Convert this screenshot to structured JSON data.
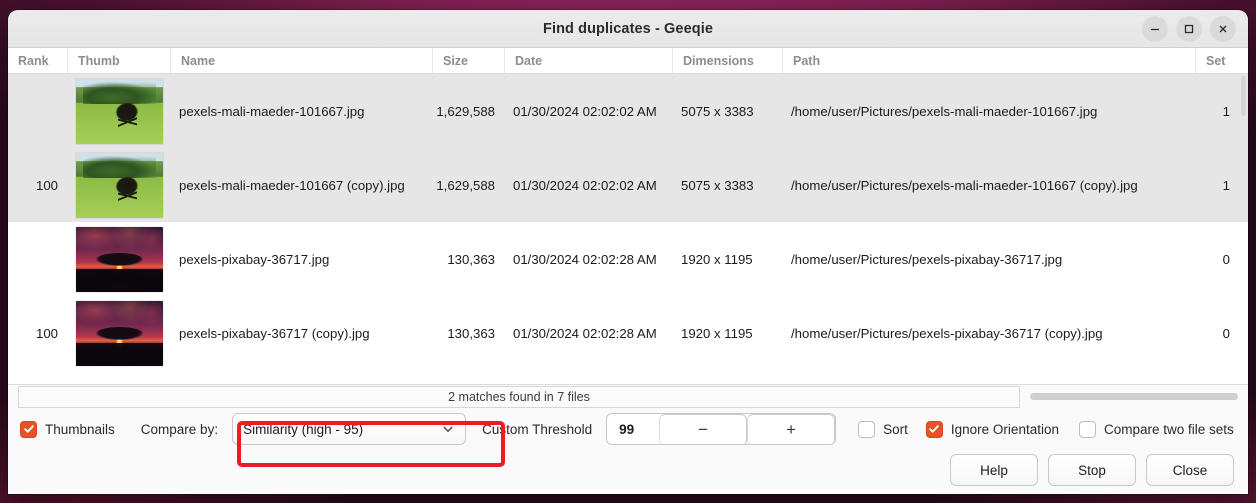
{
  "window": {
    "title": "Find duplicates - Geeqie",
    "controls": [
      {
        "name": "minimize",
        "glyph": "minimize-icon"
      },
      {
        "name": "maximize",
        "glyph": "maximize-icon"
      },
      {
        "name": "close",
        "glyph": "close-icon"
      }
    ]
  },
  "table": {
    "columns": [
      {
        "key": "rank",
        "label": "Rank"
      },
      {
        "key": "thumb",
        "label": "Thumb"
      },
      {
        "key": "name",
        "label": "Name"
      },
      {
        "key": "size",
        "label": "Size"
      },
      {
        "key": "date",
        "label": "Date"
      },
      {
        "key": "dimensions",
        "label": "Dimensions"
      },
      {
        "key": "path",
        "label": "Path"
      },
      {
        "key": "set",
        "label": "Set"
      }
    ],
    "rows": [
      {
        "rank": "",
        "name": "pexels-mali-maeder-101667.jpg",
        "size": "1,629,588",
        "date": "01/30/2024 02:02:02 AM",
        "dimensions": "5075 x 3383",
        "path": "/home/user/Pictures/pexels-mali-maeder-101667.jpg",
        "set": "1",
        "thumb_kind": "horse",
        "selected": true
      },
      {
        "rank": "100",
        "name": "pexels-mali-maeder-101667 (copy).jpg",
        "size": "1,629,588",
        "date": "01/30/2024 02:02:02 AM",
        "dimensions": "5075 x 3383",
        "path": "/home/user/Pictures/pexels-mali-maeder-101667 (copy).jpg",
        "set": "1",
        "thumb_kind": "horse",
        "selected": true
      },
      {
        "rank": "",
        "name": "pexels-pixabay-36717.jpg",
        "size": "130,363",
        "date": "01/30/2024 02:02:28 AM",
        "dimensions": "1920 x 1195",
        "path": "/home/user/Pictures/pexels-pixabay-36717.jpg",
        "set": "0",
        "thumb_kind": "volcano",
        "selected": false
      },
      {
        "rank": "100",
        "name": "pexels-pixabay-36717 (copy).jpg",
        "size": "130,363",
        "date": "01/30/2024 02:02:28 AM",
        "dimensions": "1920 x 1195",
        "path": "/home/user/Pictures/pexels-pixabay-36717 (copy).jpg",
        "set": "0",
        "thumb_kind": "volcano",
        "selected": false
      }
    ]
  },
  "status": {
    "message": "2 matches found in 7 files"
  },
  "toolbar": {
    "thumbnails_label": "Thumbnails",
    "thumbnails_checked": true,
    "compare_by_label": "Compare by:",
    "compare_by_value": "Similarity (high - 95)",
    "custom_threshold_label": "Custom Threshold",
    "threshold_value": "99",
    "threshold_decrement": "−",
    "threshold_increment": "+",
    "sort_label": "Sort",
    "sort_checked": false,
    "ignore_orientation_label": "Ignore Orientation",
    "ignore_orientation_checked": true,
    "compare_two_sets_label": "Compare two file sets",
    "compare_two_sets_checked": false
  },
  "actions": {
    "help_label": "Help",
    "stop_label": "Stop",
    "close_label": "Close"
  },
  "colors": {
    "accent_checkbox": "#e8512a",
    "annotation_highlight": "#ec1c24",
    "selected_row": "#e6e6e6",
    "desktop": "#2b0a1c"
  }
}
